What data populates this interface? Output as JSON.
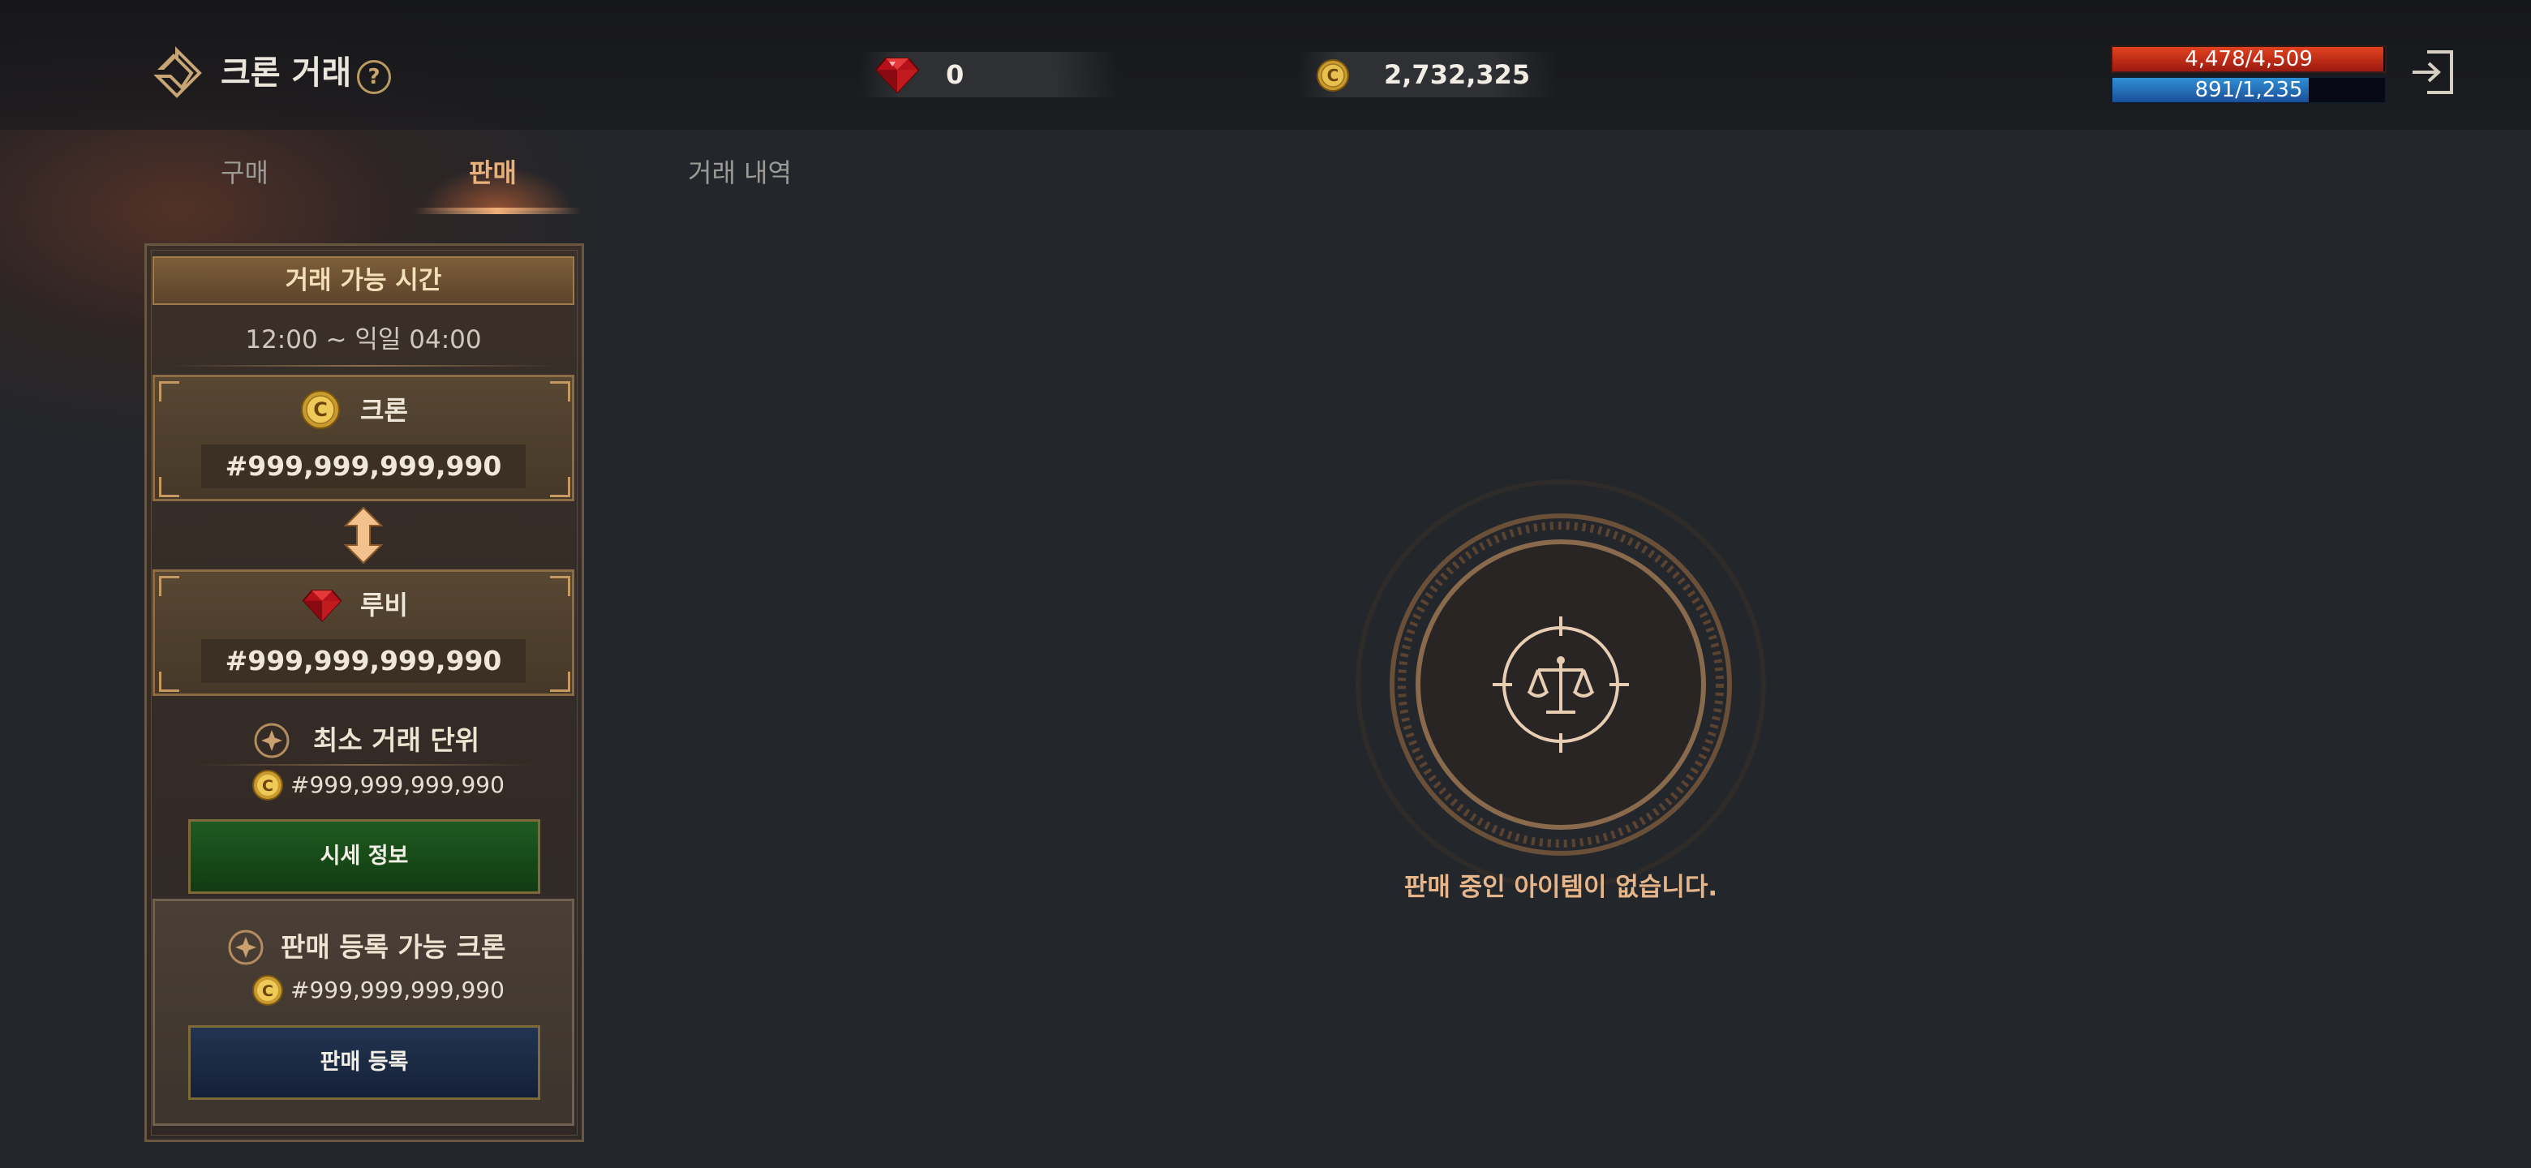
{
  "header": {
    "title": "크론 거래",
    "help_icon": "question-circle-icon",
    "ruby": {
      "icon": "ruby-gem-icon",
      "value": "0"
    },
    "cron": {
      "icon": "cron-coin-icon",
      "value": "2,732,325"
    },
    "hp": {
      "text": "4,478/4,509",
      "current": 4478,
      "max": 4509,
      "color": "#d8341a"
    },
    "mp": {
      "text": "891/1,235",
      "current": 891,
      "max": 1235,
      "color": "#2a7fc4"
    },
    "exit_icon": "exit-icon"
  },
  "tabs": [
    {
      "label": "구매",
      "active": false
    },
    {
      "label": "판매",
      "active": true
    },
    {
      "label": "거래 내역",
      "active": false
    }
  ],
  "panel": {
    "trade_time_title": "거래 가능 시간",
    "trade_time": "12:00 ~ 익일 04:00",
    "cron_box": {
      "label": "크론",
      "value": "#999,999,999,990"
    },
    "ruby_box": {
      "label": "루비",
      "value": "#999,999,999,990"
    },
    "exchange_icon": "up-down-arrow-icon",
    "min_trade": {
      "label": "최소 거래 단위",
      "value": "#999,999,999,990"
    },
    "price_info_button": "시세 정보",
    "sellable": {
      "label": "판매 등록 가능 크론",
      "value": "#999,999,999,990"
    },
    "register_button": "판매 등록"
  },
  "empty_state": {
    "icon": "scales-icon",
    "message": "판매 중인 아이템이 없습니다."
  },
  "colors": {
    "accent_orange": "#e8b07a",
    "gold_border": "#c59a62",
    "green_button": "#1f5a22",
    "blue_button": "#223452"
  }
}
